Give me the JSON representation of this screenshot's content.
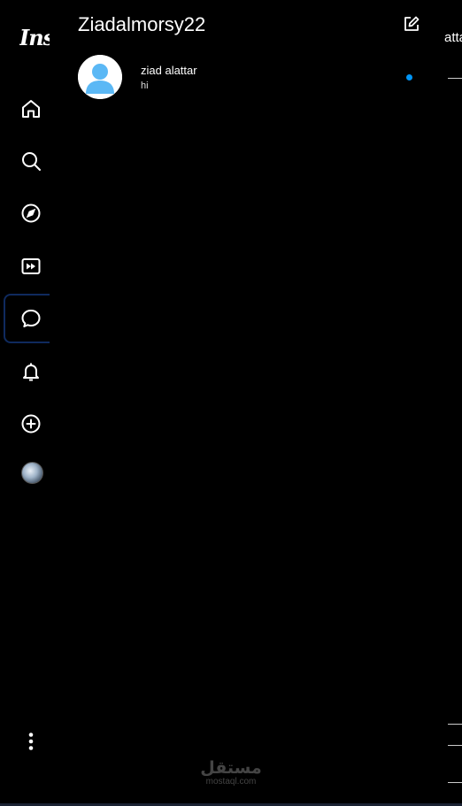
{
  "nav": {
    "logo_text": "Instagram",
    "items": [
      {
        "name": "home",
        "label": "Home"
      },
      {
        "name": "search",
        "label": "Search"
      },
      {
        "name": "explore",
        "label": "Explore"
      },
      {
        "name": "reels",
        "label": "Reels"
      },
      {
        "name": "messages",
        "label": "Messages",
        "active": true
      },
      {
        "name": "notifications",
        "label": "Notifications"
      },
      {
        "name": "create",
        "label": "Create"
      },
      {
        "name": "profile",
        "label": "Profile"
      },
      {
        "name": "more",
        "label": "More"
      }
    ]
  },
  "inbox": {
    "username": "Ziadalmorsy22",
    "threads": [
      {
        "name": "ziad alattar",
        "last_message": "hi",
        "unread": true
      }
    ]
  },
  "right_panel": {
    "text_fragment": "atta"
  },
  "watermark": {
    "arabic": "مستقل",
    "latin": "mostaql.com"
  },
  "colors": {
    "background": "#000000",
    "unread_dot": "#0095f6",
    "active_nav_border": "#0f2a5e",
    "avatar_placeholder": "#5bb8f5"
  }
}
